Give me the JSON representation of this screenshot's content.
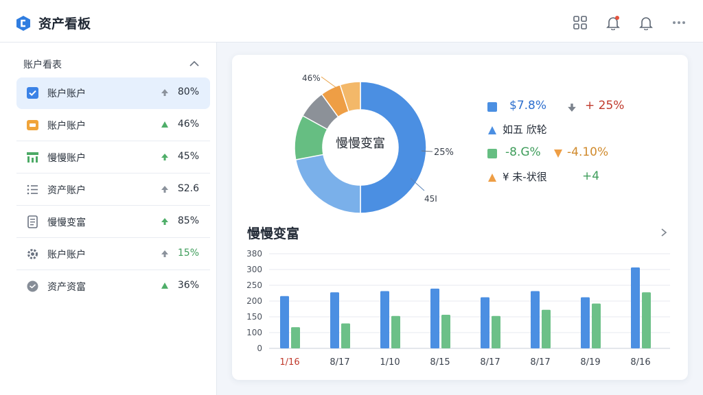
{
  "app": {
    "title": "资产看板"
  },
  "sidebar": {
    "title": "账户看表",
    "items": [
      {
        "label": "账户账户",
        "value": "80%",
        "trend": "up-gray"
      },
      {
        "label": "账户账户",
        "value": "46%",
        "trend": "up-green"
      },
      {
        "label": "慢慢账户",
        "value": "45%",
        "trend": "up-green"
      },
      {
        "label": "资产账户",
        "value": "S2.6",
        "trend": "up-gray"
      },
      {
        "label": "慢慢变富",
        "value": "85%",
        "trend": "up-green"
      },
      {
        "label": "账户账户",
        "value": "15%",
        "trend": "up-gray"
      },
      {
        "label": "资产资富",
        "value": "36%",
        "trend": "up-green"
      }
    ]
  },
  "donut": {
    "center_label": "慢慢变富",
    "label_top": "46%",
    "label_right": "25%",
    "label_bottom": "45I",
    "colors": [
      "#4b8fe2",
      "#7ab0ea",
      "#66be82",
      "#8c9198",
      "#ee9e45",
      "#f3b869"
    ]
  },
  "legend": {
    "row1": {
      "value": "$7.8%",
      "change": "+ 25%"
    },
    "row2": {
      "text": "如五 欣轮"
    },
    "row3": {
      "value": "-8.G%",
      "change": "-4.10%"
    },
    "row4": {
      "text": "¥ 未-状很",
      "change": "+4"
    }
  },
  "section": {
    "title": "慢慢变富"
  },
  "chart_data": {
    "type": "bar",
    "categories": [
      "1/16",
      "8/17",
      "1/10",
      "8/15",
      "8/17",
      "8/17",
      "8/19",
      "8/16"
    ],
    "series": [
      {
        "values": [
          210,
          225,
          230,
          240,
          205,
          230,
          205,
          325
        ]
      },
      {
        "values": [
          85,
          100,
          130,
          135,
          130,
          155,
          180,
          225
        ]
      }
    ],
    "y_ticks": [
      "0",
      "100",
      "150",
      "200",
      "250",
      "300",
      "380"
    ],
    "ylim": [
      0,
      380
    ],
    "colors": [
      "#4b8fe2",
      "#6cc088"
    ],
    "first_label_color": "#c0392b"
  }
}
